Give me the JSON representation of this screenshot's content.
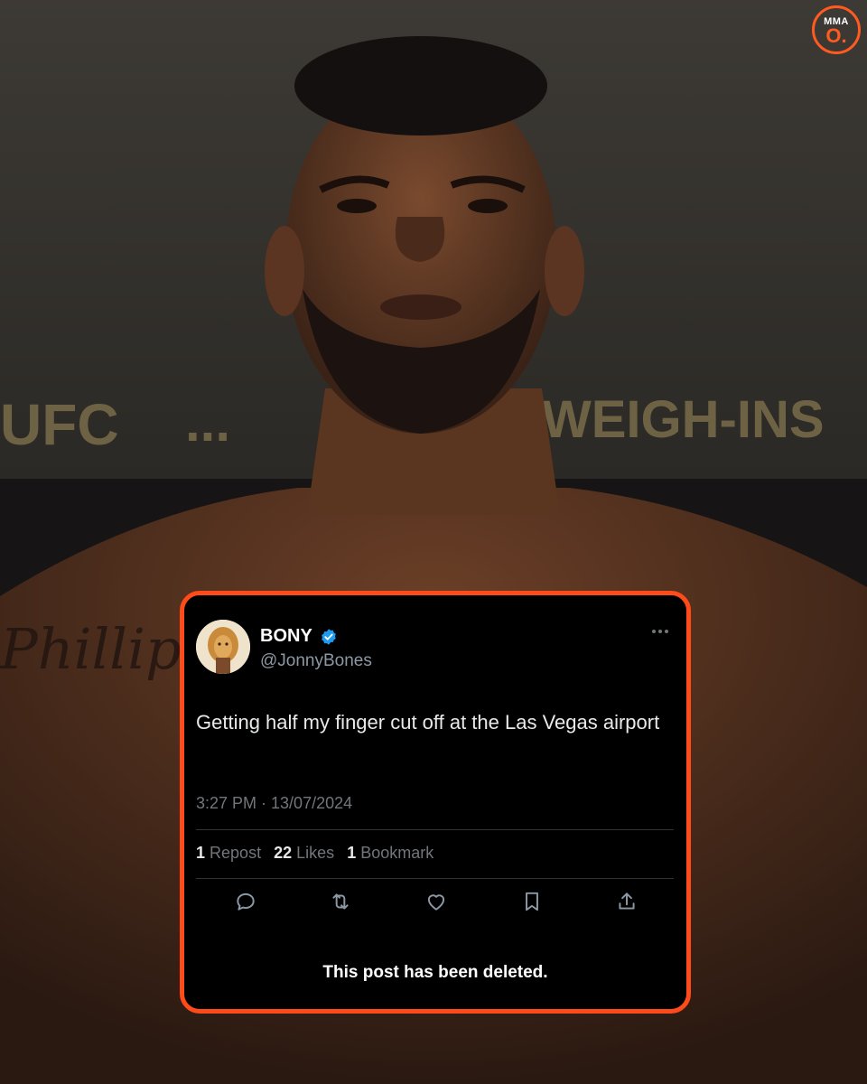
{
  "brand": {
    "logo_top": "MMA",
    "logo_bottom": "O.",
    "accent": "#ff5a1f"
  },
  "photo": {
    "background_words": [
      "UFC",
      "...",
      "WEIGH-INS"
    ],
    "tattoo_text": "Phillip"
  },
  "tweet": {
    "display_name": "BONY",
    "handle": "@JonnyBones",
    "verified": true,
    "text": "Getting half my finger cut off at the Las Vegas airport",
    "timestamp": "3:27 PM · 13/07/2024",
    "reposts_count": "1",
    "reposts_label": "Repost",
    "likes_count": "22",
    "likes_label": "Likes",
    "bookmarks_count": "1",
    "bookmarks_label": "Bookmark",
    "icons": [
      "reply-icon",
      "repost-icon",
      "like-icon",
      "bookmark-icon",
      "share-icon",
      "more-icon",
      "verified-badge-icon"
    ],
    "deleted_notice": "This post has been deleted."
  },
  "colors": {
    "card_bg": "#000000",
    "card_border": "#ff4a1a",
    "text_primary": "#e7e9ea",
    "text_secondary": "#71767b",
    "verified": "#1d9bf0"
  }
}
